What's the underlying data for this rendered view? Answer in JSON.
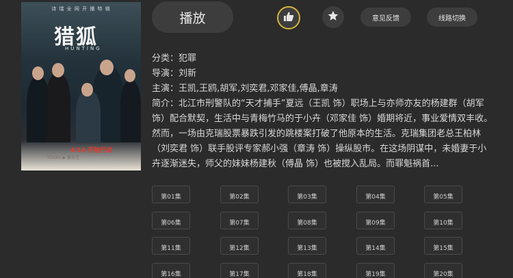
{
  "poster": {
    "tagline": "诗 瑞 全 网 开 播 特 辑",
    "title": "猎狐",
    "subtitle": "HUNTING",
    "date_text": "4/14 开始行动",
    "logos_text": "YOUKU ▶ 爱奇艺"
  },
  "actions": {
    "play_label": "播放",
    "like_icon": "thumbs-up-icon",
    "favorite_icon": "star-icon",
    "feedback_label": "意见反馈",
    "line_switch_label": "线路切换"
  },
  "info": {
    "category": "分类：犯罪",
    "director": "导演：刘新",
    "cast": "主演：王凯,王鸥,胡军,刘奕君,邓家佳,傅晶,章涛",
    "description": "简介：北江市刑警队的“天才捕手”夏远（王凯 饰）职场上与亦师亦友的杨建群（胡军饰）配合默契，生活中与青梅竹马的于小卉（邓家佳 饰）婚期将近，事业爱情双丰收。然而，一场由克瑞股票暴跌引发的跳楼案打破了他原本的生活。克瑞集团老总王柏林（刘奕君 饰）联手股评专家郝小强（章涛 饰）操纵股市。在这场阴谋中，未婚妻于小卉逐渐迷失，师父的妹妹杨建秋（傅晶 饰）也被搅入乱局。而罪魁祸首..."
  },
  "episodes": [
    "第01集",
    "第02集",
    "第03集",
    "第04集",
    "第05集",
    "第06集",
    "第07集",
    "第08集",
    "第09集",
    "第10集",
    "第11集",
    "第12集",
    "第13集",
    "第14集",
    "第15集",
    "第16集",
    "第17集",
    "第18集",
    "第19集",
    "第20集"
  ],
  "colors": {
    "background": "#2b2b2b",
    "button": "#3d3d3d",
    "like_ring": "#d6b43a"
  }
}
